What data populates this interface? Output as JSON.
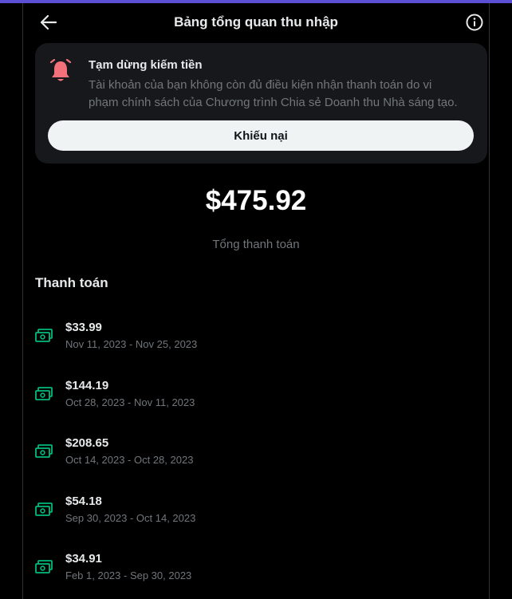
{
  "header": {
    "title": "Bảng tổng quan thu nhập"
  },
  "alert": {
    "title": "Tạm dừng kiếm tiền",
    "body": "Tài khoản của bạn không còn đủ điều kiện nhận thanh toán do vi phạm chính sách của Chương trình Chia sẻ Doanh thu Nhà sáng tạo.",
    "button_label": "Khiếu nại"
  },
  "summary": {
    "total": "$475.92",
    "label": "Tổng thanh toán"
  },
  "payouts": {
    "section_title": "Thanh toán",
    "items": [
      {
        "amount": "$33.99",
        "range": "Nov 11, 2023 - Nov 25, 2023"
      },
      {
        "amount": "$144.19",
        "range": "Oct 28, 2023 - Nov 11, 2023"
      },
      {
        "amount": "$208.65",
        "range": "Oct 14, 2023 - Oct 28, 2023"
      },
      {
        "amount": "$54.18",
        "range": "Sep 30, 2023 - Oct 14, 2023"
      },
      {
        "amount": "$34.91",
        "range": "Feb 1, 2023 - Sep 30, 2023"
      }
    ]
  },
  "colors": {
    "accent_bar": "#5b4fd6",
    "bell": "#f4707b",
    "cash_icon": "#00ba7c"
  },
  "icons": [
    "arrow-left-icon",
    "info-icon",
    "bell-icon",
    "cash-icon"
  ]
}
